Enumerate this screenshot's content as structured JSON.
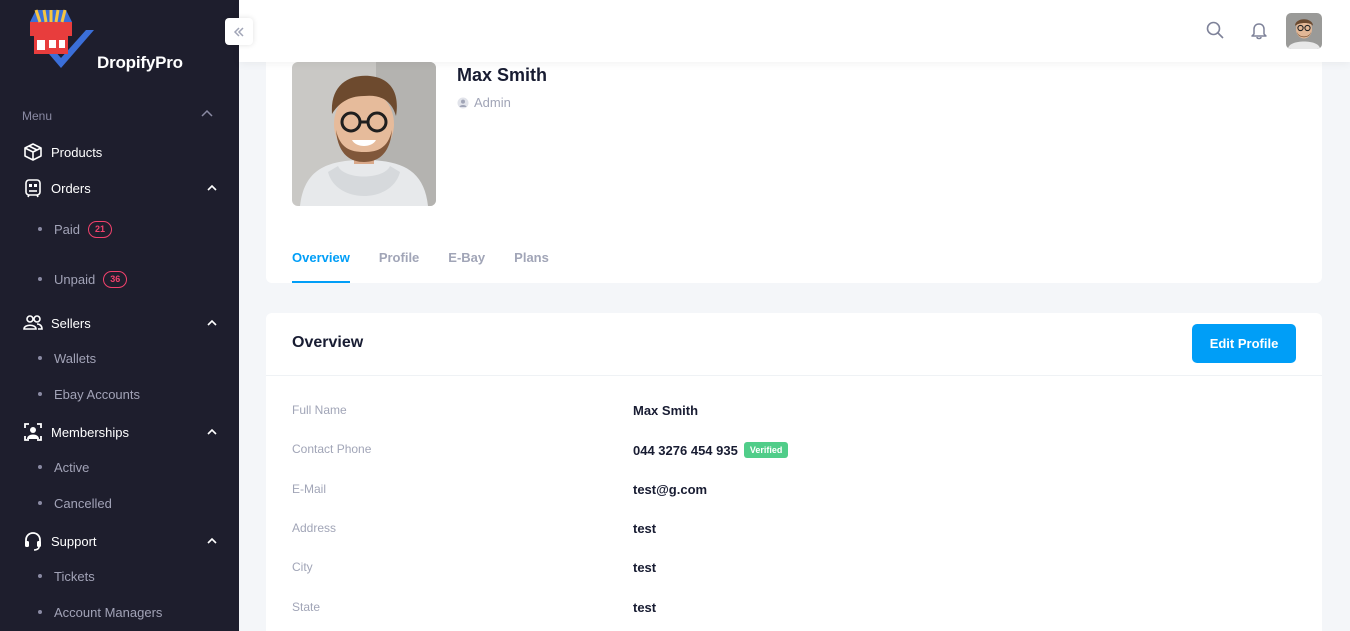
{
  "brand": {
    "name": "DropifyPro"
  },
  "sidebar": {
    "menu_heading": "Menu",
    "products": "Products",
    "orders": "Orders",
    "orders_paid": "Paid",
    "orders_paid_count": "21",
    "orders_unpaid": "Unpaid",
    "orders_unpaid_count": "36",
    "sellers": "Sellers",
    "sellers_wallets": "Wallets",
    "sellers_ebay": "Ebay Accounts",
    "memberships": "Memberships",
    "memberships_active": "Active",
    "memberships_cancelled": "Cancelled",
    "support": "Support",
    "support_tickets": "Tickets",
    "support_managers": "Account Managers"
  },
  "profile": {
    "name": "Max Smith",
    "role": "Admin",
    "tabs": [
      "Overview",
      "Profile",
      "E-Bay",
      "Plans"
    ]
  },
  "overview": {
    "title": "Overview",
    "edit_label": "Edit Profile",
    "verified_label": "Verified",
    "rows": [
      {
        "label": "Full Name",
        "value": "Max Smith"
      },
      {
        "label": "Contact Phone",
        "value": "044 3276 454 935"
      },
      {
        "label": "E-Mail",
        "value": "test@g.com"
      },
      {
        "label": "Address",
        "value": "test"
      },
      {
        "label": "City",
        "value": "test"
      },
      {
        "label": "State",
        "value": "test"
      }
    ]
  },
  "icons": {
    "collapse": "double-chevron-left-icon",
    "search": "search-icon",
    "notifications": "bell-icon"
  },
  "colors": {
    "primary": "#009ef7",
    "sidebar_bg": "#1e1e2d",
    "success": "#50cd89",
    "danger": "#f1416c"
  }
}
